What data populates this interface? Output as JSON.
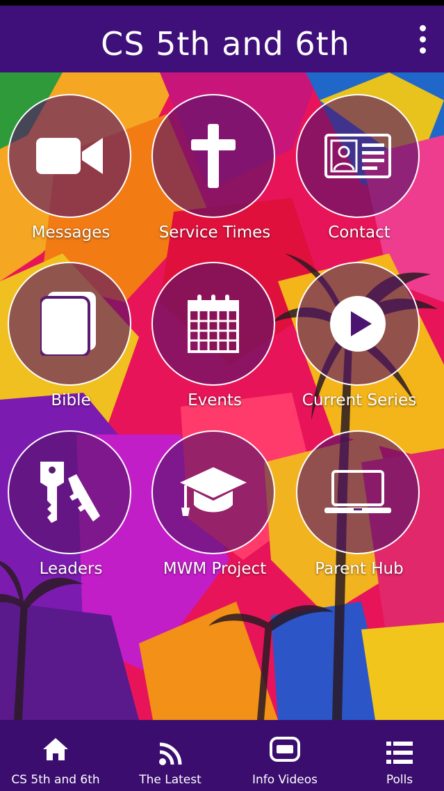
{
  "app": {
    "title": "CS 5th and 6th"
  },
  "colors": {
    "app_bar": "#3f0f7a",
    "tab_bar": "#3a0d6e",
    "circle_fill": "#551469"
  },
  "grid": [
    {
      "label": "Messages",
      "icon": "video-camera-icon"
    },
    {
      "label": "Service Times",
      "icon": "cross-icon"
    },
    {
      "label": "Contact",
      "icon": "contact-card-icon"
    },
    {
      "label": "Bible",
      "icon": "book-icon"
    },
    {
      "label": "Events",
      "icon": "calendar-icon"
    },
    {
      "label": "Current Series",
      "icon": "play-icon"
    },
    {
      "label": "Leaders",
      "icon": "keys-icon"
    },
    {
      "label": "MWM Project",
      "icon": "graduation-cap-icon"
    },
    {
      "label": "Parent Hub",
      "icon": "laptop-icon"
    }
  ],
  "tabs": [
    {
      "label": "CS 5th and 6th",
      "icon": "home-icon"
    },
    {
      "label": "The Latest",
      "icon": "rss-icon"
    },
    {
      "label": "Info Videos",
      "icon": "hd-video-icon"
    },
    {
      "label": "Polls",
      "icon": "list-icon"
    }
  ]
}
